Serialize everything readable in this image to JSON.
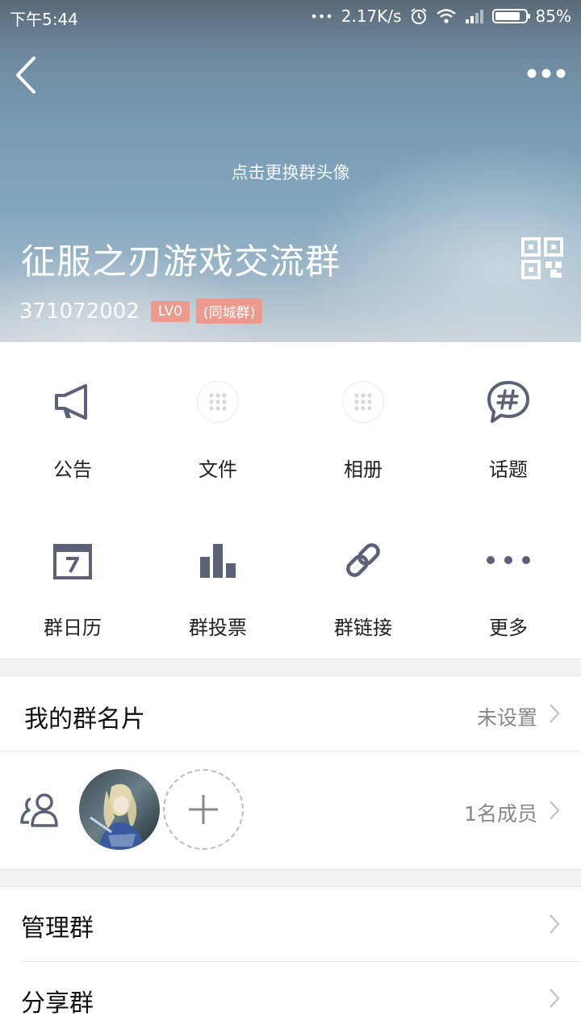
{
  "status_bar": {
    "time": "下午5:44",
    "signal_dots": "•••",
    "net_speed": "2.17K/s",
    "battery_percent": "85%",
    "battery_level": 0.85
  },
  "header": {
    "avatar_hint": "点击更换群头像",
    "group_name": "征服之刃游戏交流群",
    "group_id": "371072002",
    "level_badge": "LV0",
    "type_badge": "(同城群)"
  },
  "features": [
    {
      "label": "公告",
      "icon": "megaphone-icon"
    },
    {
      "label": "文件",
      "icon": "app-placeholder-icon"
    },
    {
      "label": "相册",
      "icon": "app-placeholder-icon"
    },
    {
      "label": "话题",
      "icon": "hashtag-bubble-icon"
    },
    {
      "label": "群日历",
      "icon": "calendar-icon"
    },
    {
      "label": "群投票",
      "icon": "bar-chart-icon"
    },
    {
      "label": "群链接",
      "icon": "link-icon"
    },
    {
      "label": "更多",
      "icon": "more-dots-icon"
    }
  ],
  "my_card": {
    "title": "我的群名片",
    "value": "未设置"
  },
  "members": {
    "count_text": "1名成员"
  },
  "manage_group": {
    "title": "管理群"
  },
  "share_group": {
    "title": "分享群"
  },
  "colors": {
    "icon": "#5b6277",
    "badge": "#ec9a8d",
    "separator": "#f2f2f2"
  }
}
